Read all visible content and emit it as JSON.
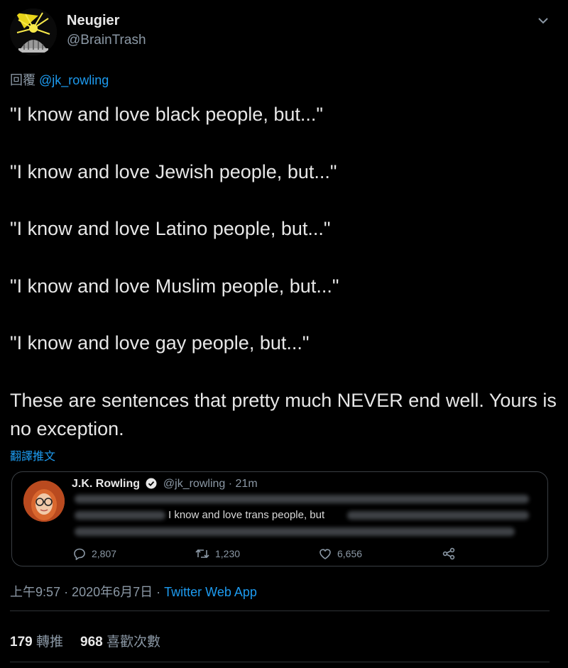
{
  "author": {
    "name": "Neugier",
    "handle": "@BrainTrash"
  },
  "reply_to": {
    "prefix": "回覆",
    "mention": "@jk_rowling"
  },
  "tweet_paragraphs": [
    "\"I know and love black people, but...\"",
    "\"I know and love Jewish people, but...\"",
    "\"I know and love Latino people, but...\"",
    "\"I know and love Muslim people, but...\"",
    "\"I know and love gay people, but...\"",
    "These are sentences that pretty much NEVER end well. Yours is no exception."
  ],
  "translate_label": "翻譯推文",
  "quoted_tweet": {
    "name": "J.K. Rowling",
    "handle": "@jk_rowling",
    "time": "· 21m",
    "visible_text": "I know and love trans people, but",
    "reply_count": "2,807",
    "retweet_count": "1,230",
    "like_count": "6,656"
  },
  "meta": {
    "time": "上午9:57",
    "date": "· 2020年6月7日 ·",
    "source": "Twitter Web App"
  },
  "stats": {
    "retweets_count": "179",
    "retweets_label": "轉推",
    "likes_count": "968",
    "likes_label": "喜歡次數"
  },
  "colors": {
    "background": "#000000",
    "link": "#1d9bf0",
    "secondary_text": "#8b98a5",
    "divider": "#2f3336"
  },
  "icons": [
    "avatar-image",
    "chevron-down-icon",
    "verified-badge-icon",
    "reply-icon",
    "retweet-icon",
    "like-icon",
    "share-icon"
  ]
}
